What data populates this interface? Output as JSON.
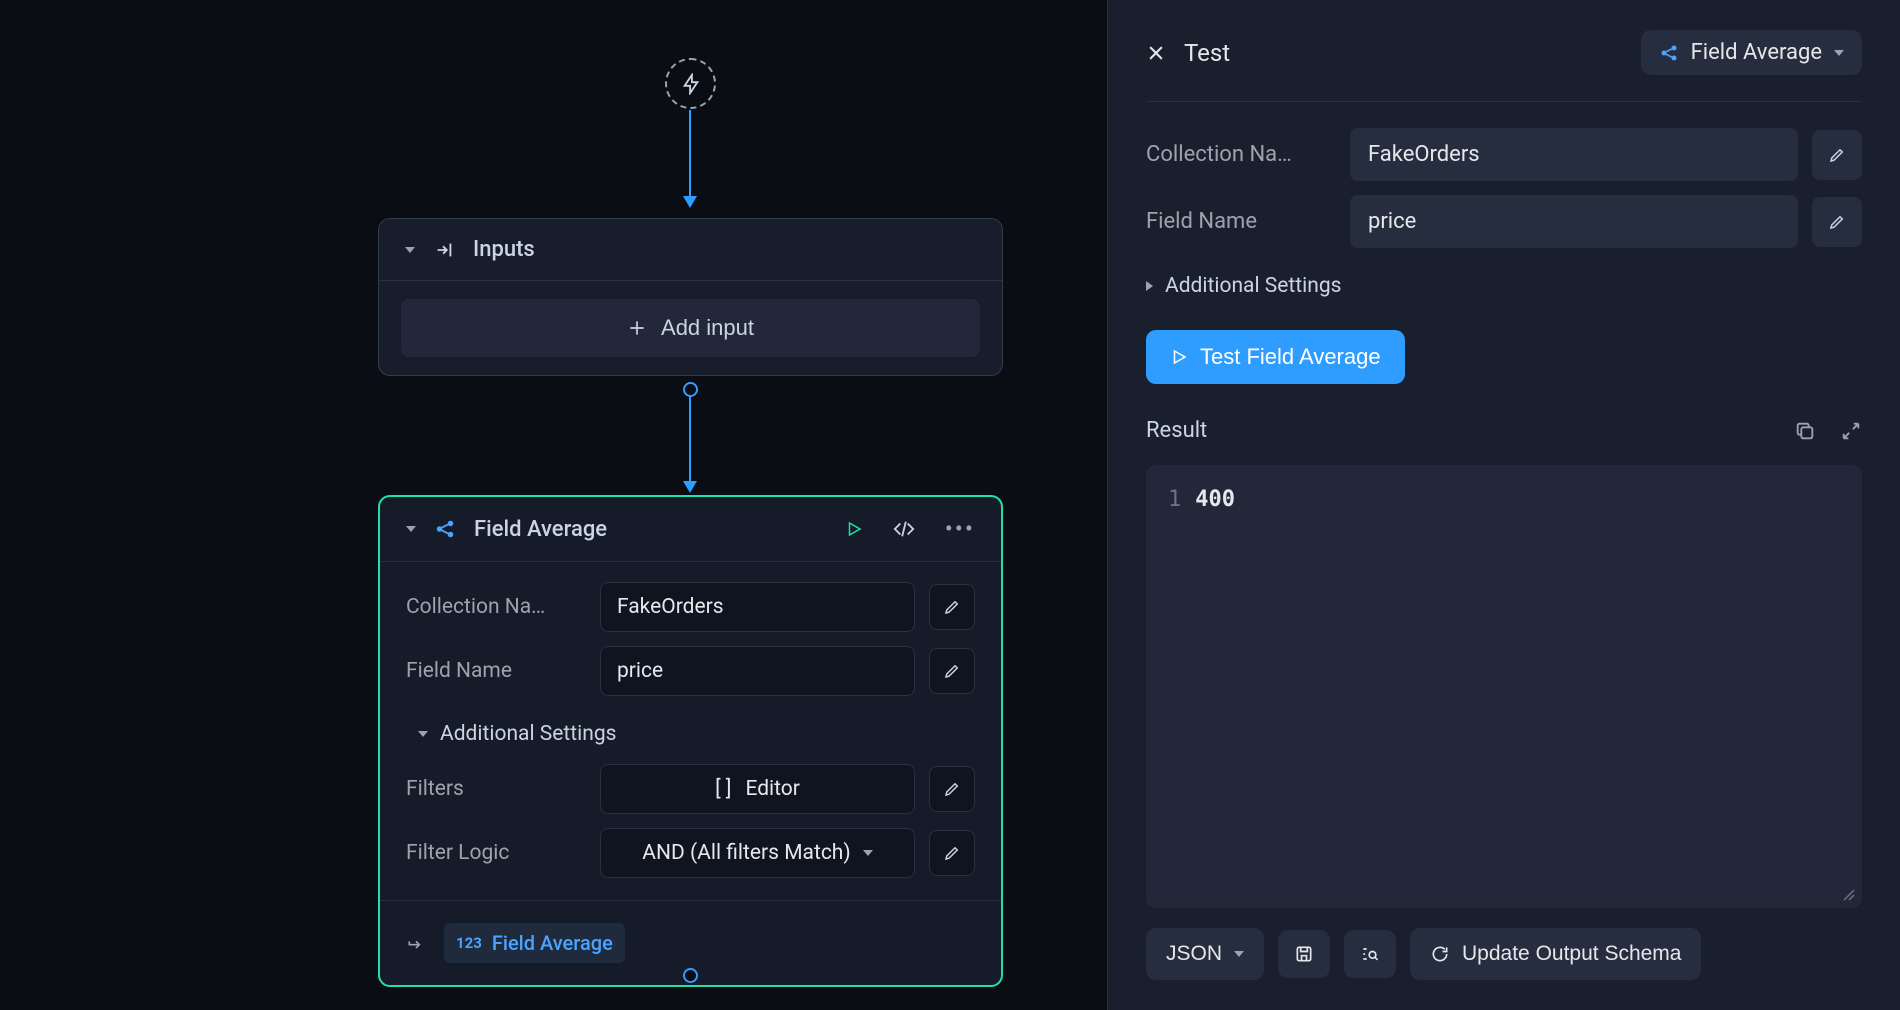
{
  "canvas": {
    "inputs_node": {
      "title": "Inputs",
      "add_label": "Add input"
    },
    "fa_node": {
      "title": "Field Average",
      "fields": {
        "collection_label": "Collection Na…",
        "collection_value": "FakeOrders",
        "field_label": "Field Name",
        "field_value": "price",
        "settings_label": "Additional Settings",
        "filters_label": "Filters",
        "filters_value": "Editor",
        "filters_prefix": "[ ]",
        "logic_label": "Filter Logic",
        "logic_value": "AND (All filters Match)"
      },
      "output_label": "Field Average",
      "output_type_badge": "123"
    }
  },
  "panel": {
    "title": "Test",
    "selector_label": "Field Average",
    "fields": {
      "collection_label": "Collection Na…",
      "collection_value": "FakeOrders",
      "field_label": "Field Name",
      "field_value": "price",
      "settings_label": "Additional Settings"
    },
    "test_button": "Test Field Average",
    "result_label": "Result",
    "result_line_num": "1",
    "result_value": "400",
    "footer": {
      "format": "JSON",
      "update_schema": "Update Output Schema"
    }
  }
}
